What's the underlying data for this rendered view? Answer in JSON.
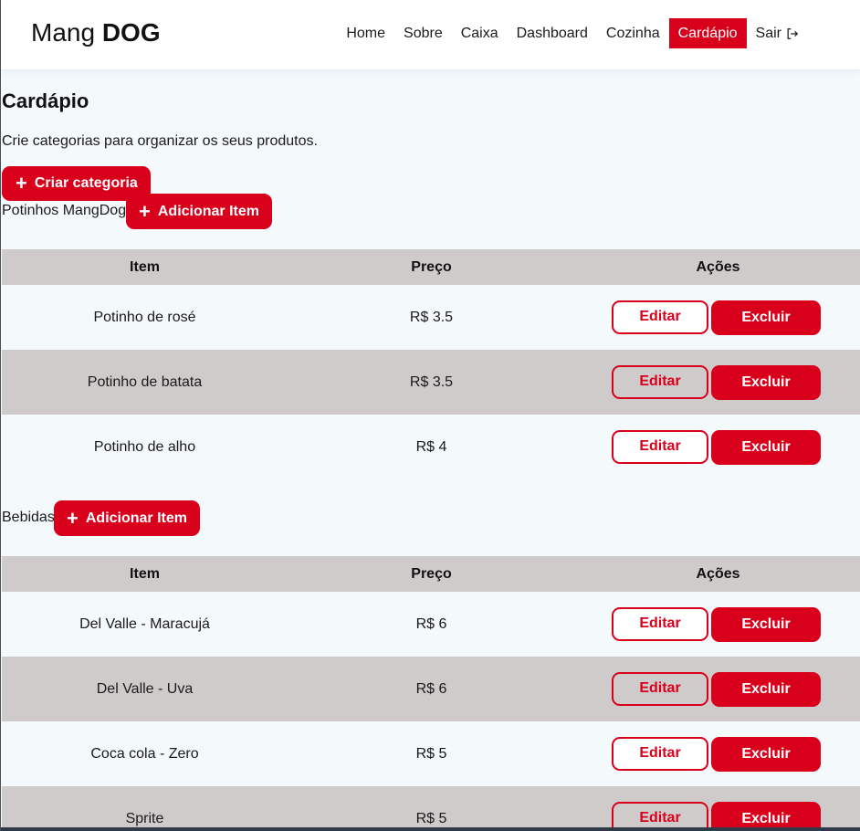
{
  "brand": {
    "light": "Mang ",
    "bold": "DOG"
  },
  "nav": {
    "home": "Home",
    "sobre": "Sobre",
    "caixa": "Caixa",
    "dashboard": "Dashboard",
    "cozinha": "Cozinha",
    "cardapio": "Cardápio",
    "sair": "Sair",
    "active": "Cardápio",
    "sair_icon": "exit-icon"
  },
  "page": {
    "title": "Cardápio",
    "description": "Crie categorias para organizar os seus produtos.",
    "create_category_label": "Criar categoria"
  },
  "headers": {
    "item": "Item",
    "price": "Preço",
    "actions": "Ações"
  },
  "buttons": {
    "add_item": "Adicionar Item",
    "edit": "Editar",
    "delete": "Excluir"
  },
  "colors": {
    "accent": "#d9001b",
    "row_alt": "#cfcbcb",
    "background": "#f4f9fc"
  },
  "categories": [
    {
      "name": "Potinhos MangDog",
      "items": [
        {
          "name": "Potinho de rosé",
          "price": "R$ 3.5"
        },
        {
          "name": "Potinho de batata",
          "price": "R$ 3.5"
        },
        {
          "name": "Potinho de alho",
          "price": "R$ 4"
        }
      ]
    },
    {
      "name": "Bebidas",
      "items": [
        {
          "name": "Del Valle - Maracujá",
          "price": "R$ 6"
        },
        {
          "name": "Del Valle - Uva",
          "price": "R$ 6"
        },
        {
          "name": "Coca cola - Zero",
          "price": "R$ 5"
        },
        {
          "name": "Sprite",
          "price": "R$ 5"
        }
      ]
    }
  ]
}
